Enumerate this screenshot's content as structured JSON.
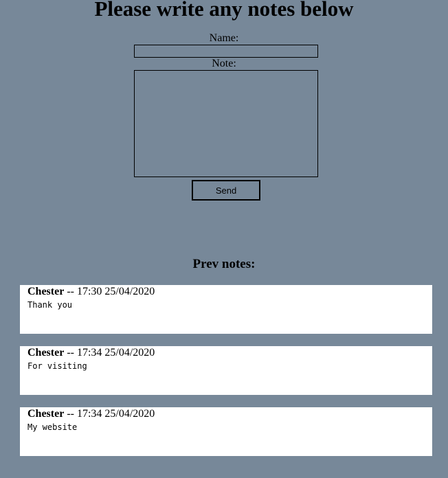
{
  "form": {
    "title": "Please write any notes below",
    "name_label": "Name:",
    "name_value": "",
    "note_label": "Note:",
    "note_value": "",
    "send_label": "Send"
  },
  "notes_section": {
    "heading": "Prev notes:",
    "separator": " -- ",
    "notes": [
      {
        "author": "Chester",
        "time": "17:30 25/04/2020",
        "text": "Thank you"
      },
      {
        "author": "Chester",
        "time": "17:34 25/04/2020",
        "text": "For visiting"
      },
      {
        "author": "Chester",
        "time": "17:34 25/04/2020",
        "text": "My website"
      }
    ]
  },
  "colors": {
    "page_background": "#778899",
    "card_background": "#ffffff"
  }
}
